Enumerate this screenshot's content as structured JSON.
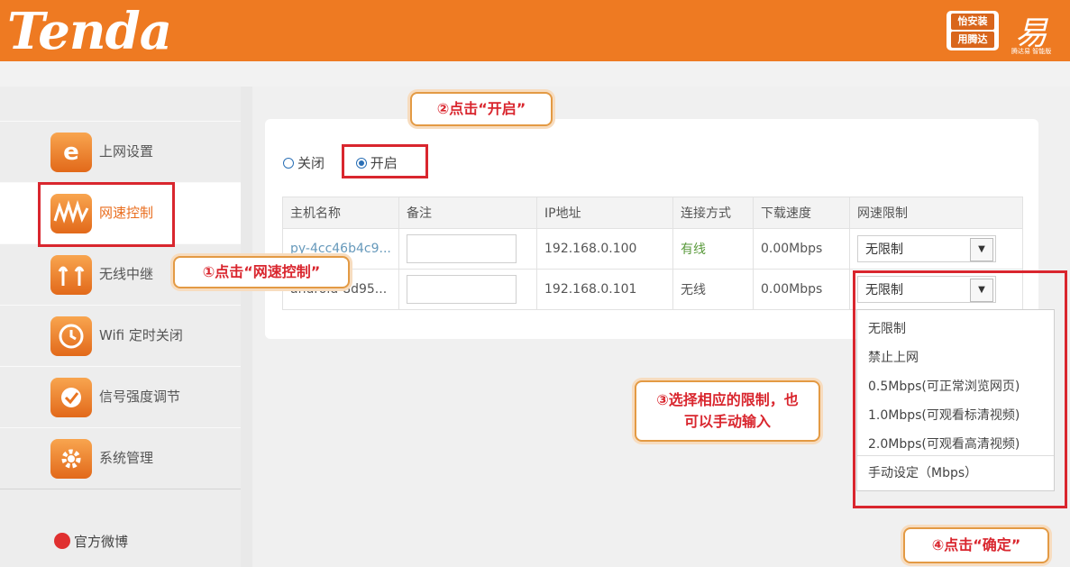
{
  "header": {
    "logo_text": "Tenda",
    "badge_line1": "怡安装",
    "badge_line2": "用腾达",
    "secondary_logo_glyph": "易",
    "secondary_logo_text": "腾达易 智能版"
  },
  "sidebar": {
    "items": [
      {
        "label": "上网设置",
        "icon": "internet-explorer-e-icon"
      },
      {
        "label": "网速控制",
        "icon": "waveform-icon"
      },
      {
        "label": "无线中继",
        "icon": "antenna-icon"
      },
      {
        "label": "Wifi 定时关闭",
        "icon": "timer-icon"
      },
      {
        "label": "信号强度调节",
        "icon": "signal-toggle-icon"
      },
      {
        "label": "系统管理",
        "icon": "gear-icon"
      }
    ],
    "weibo_label": "官方微博"
  },
  "radio": {
    "off_label": "关闭",
    "on_label": "开启",
    "selected": "on"
  },
  "table": {
    "headers": [
      "主机名称",
      "备注",
      "IP地址",
      "连接方式",
      "下载速度",
      "网速限制"
    ],
    "rows": [
      {
        "host": "py-4cc46b4c9...",
        "note": "",
        "ip": "192.168.0.100",
        "conn": "有线",
        "speed": "0.00Mbps",
        "limit": "无限制"
      },
      {
        "host": "android-8d95...",
        "note": "",
        "ip": "192.168.0.101",
        "conn": "无线",
        "speed": "0.00Mbps",
        "limit": "无限制"
      }
    ]
  },
  "dropdown": {
    "options": [
      "无限制",
      "禁止上网",
      "0.5Mbps(可正常浏览网页)",
      "1.0Mbps(可观看标清视频)",
      "2.0Mbps(可观看高清视频)",
      "手动设定（Mbps）"
    ]
  },
  "callouts": {
    "step1": "①点击“网速控制”",
    "step2": "②点击“开启”",
    "step3": "③选择相应的限制，也可以手动输入",
    "step4": "④点击“确定”"
  },
  "colors": {
    "brand_orange": "#ee7a22",
    "highlight_red": "#d9262e",
    "callout_border": "#e39a44",
    "radio_blue": "#2a6fb5"
  }
}
